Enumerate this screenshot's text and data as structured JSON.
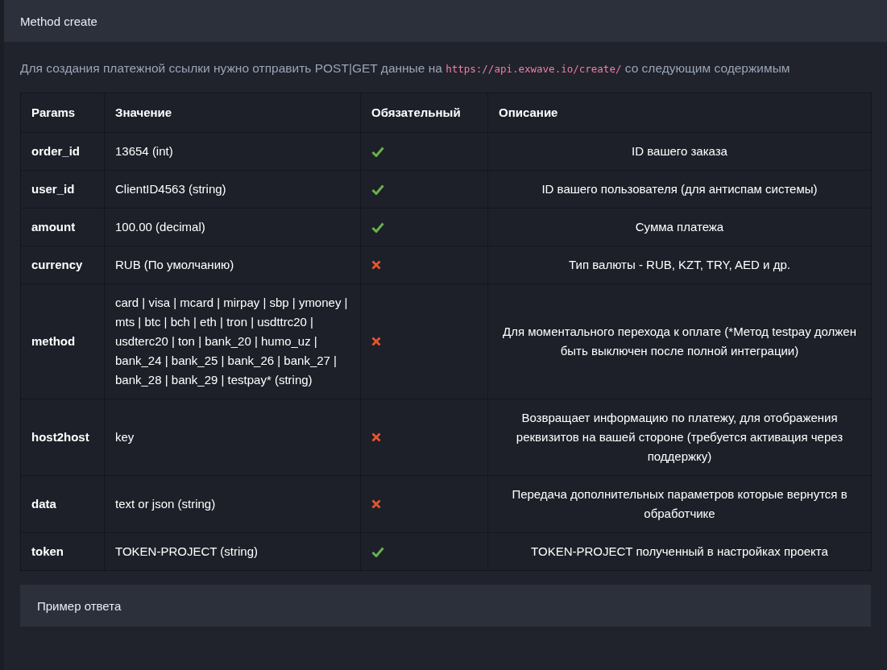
{
  "card": {
    "title": "Method create"
  },
  "intro": {
    "before": "Для создания платежной ссылки нужно отправить POST|GET данные на",
    "url": "https://api.exwave.io/create/",
    "after": "со следующим содержимым"
  },
  "table": {
    "columns": [
      "Params",
      "Значение",
      "Обязательный",
      "Описание"
    ],
    "rows": [
      {
        "param": "order_id",
        "value": "13654 (int)",
        "required": true,
        "description": "ID вашего заказа"
      },
      {
        "param": "user_id",
        "value": "ClientID4563 (string)",
        "required": true,
        "description": "ID вашего пользователя (для антиспам системы)"
      },
      {
        "param": "amount",
        "value": "100.00 (decimal)",
        "required": true,
        "description": "Сумма платежа"
      },
      {
        "param": "currency",
        "value": "RUB (По умолчанию)",
        "required": false,
        "description": "Тип валюты - RUB, KZT, TRY, AED и др."
      },
      {
        "param": "method",
        "value": "card | visa | mcard | mirpay | sbp | ymoney | mts | btc | bch | eth | tron | usdttrc20 | usdterc20 | ton | bank_20 | humo_uz | bank_24 | bank_25 | bank_26 | bank_27 | bank_28 | bank_29 | testpay* (string)",
        "required": false,
        "description": "Для моментального перехода к оплате (*Метод testpay должен быть выключен после полной интеграции)"
      },
      {
        "param": "host2host",
        "value": "key",
        "required": false,
        "description": "Возвращает информацию по платежу, для отображения реквизитов на вашей стороне (требуется активация через поддержку)"
      },
      {
        "param": "data",
        "value": "text or json (string)",
        "required": false,
        "description": "Передача дополнительных параметров которые вернутся в обработчике"
      },
      {
        "param": "token",
        "value": "TOKEN-PROJECT (string)",
        "required": true,
        "description": "TOKEN-PROJECT полученный в настройках проекта"
      }
    ]
  },
  "example": {
    "title": "Пример ответа"
  }
}
